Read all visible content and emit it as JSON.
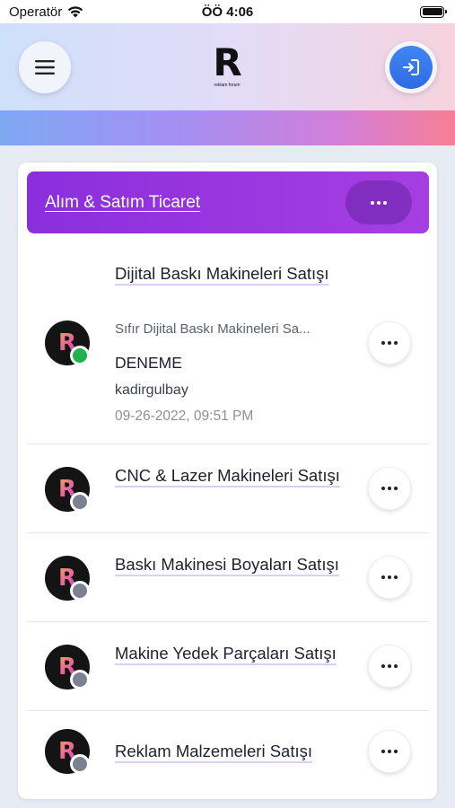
{
  "status_bar": {
    "carrier": "Operatör",
    "time": "ÖÖ 4:06",
    "icons": [
      "wifi-icon",
      "battery-icon"
    ]
  },
  "header": {
    "logo_letter": "R",
    "logo_subtitle": "reklam forum",
    "menu_icon": "hamburger-menu-icon",
    "logout_icon": "logout-icon"
  },
  "category": {
    "title": "Alım & Satım Ticaret",
    "more_icon": "ellipsis-icon"
  },
  "forums": [
    {
      "title": "Dijital Baskı Makineleri Satışı",
      "description": "Sıfır Dijital Baskı Makineleri Sa...",
      "last_topic": "DENEME",
      "last_user": "kadirgulbay",
      "last_date": "09-26-2022, 09:51 PM",
      "status": "online"
    },
    {
      "title": "CNC & Lazer Makineleri Satışı",
      "status": "offline"
    },
    {
      "title": "Baskı Makinesi Boyaları Satışı",
      "status": "offline"
    },
    {
      "title": "Makine Yedek Parçaları Satışı",
      "status": "offline"
    },
    {
      "title": "Reklam Malzemeleri Satışı",
      "status": "offline"
    }
  ],
  "colors": {
    "category_header": "#9333e0",
    "online": "#22b24c",
    "offline": "#7a8292",
    "logout_button": "#3a7cf0"
  }
}
